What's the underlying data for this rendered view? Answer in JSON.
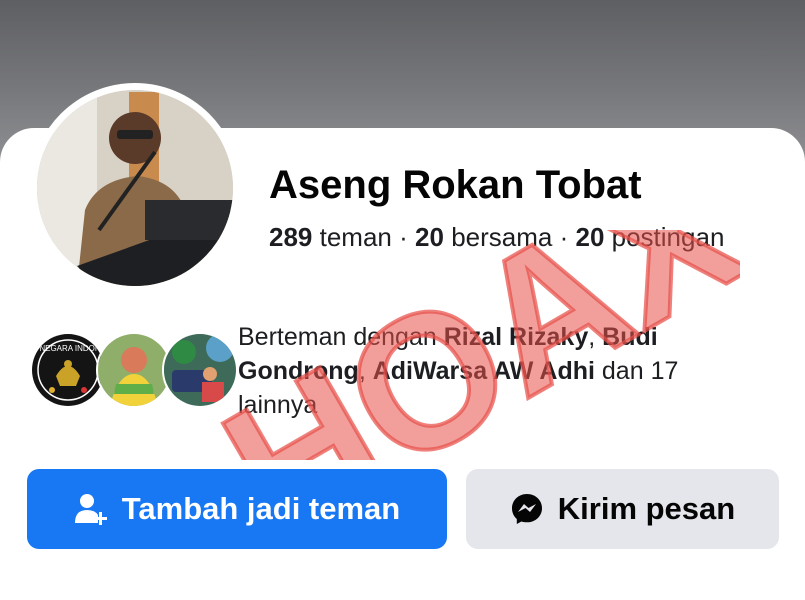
{
  "profile": {
    "name": "Aseng Rokan Tobat",
    "stats": {
      "friends_count": "289",
      "friends_label": "teman",
      "mutual_count": "20",
      "mutual_label": "bersama",
      "posts_count": "20",
      "posts_label": "postingan",
      "separator": "·"
    }
  },
  "mutual_friends": {
    "prefix": "Berteman dengan",
    "names": [
      "Rizal Rizaky",
      "Budi Gondrong",
      "AdiWarsa AW Adhi"
    ],
    "sep1": ",",
    "sep2": ",",
    "suffix": "dan 17 lainnya"
  },
  "mutual_avatars": [
    {
      "label": "BELA NEGARA INDONESIA",
      "kind": "logo-avatar"
    },
    {
      "kind": "photo-avatar"
    },
    {
      "kind": "photo-avatar"
    }
  ],
  "actions": {
    "add_friend": {
      "label": "Tambah jadi teman",
      "icon": "add-friend-icon"
    },
    "message": {
      "label": "Kirim pesan",
      "icon": "messenger-icon"
    }
  },
  "overlay": {
    "stamp_text": "HOAX"
  },
  "colors": {
    "primary_button": "#1877f2",
    "secondary_button": "#e4e6eb",
    "stamp": "#e8504a"
  }
}
